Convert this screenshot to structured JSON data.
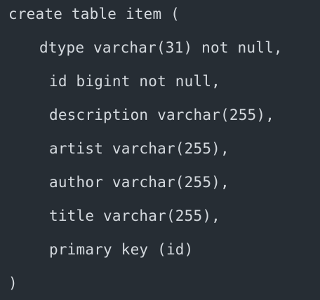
{
  "code": {
    "lines": [
      "create table item (",
      "dtype varchar(31) not null,",
      "id bigint not null,",
      "description varchar(255),",
      "artist varchar(255),",
      "author varchar(255),",
      "title varchar(255),",
      "primary key (id)",
      ")"
    ]
  }
}
